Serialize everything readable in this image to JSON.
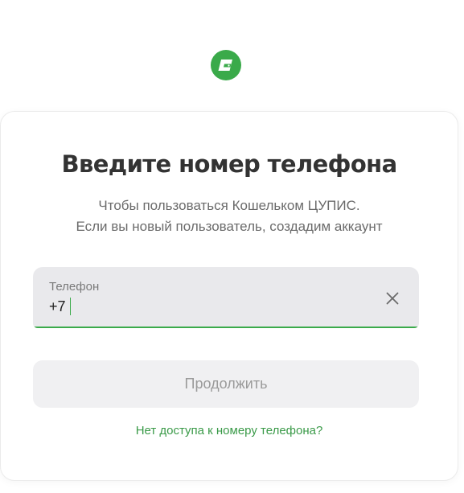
{
  "logo": {
    "icon": "wallet-logo-icon",
    "color": "#3aaa4a"
  },
  "header": {
    "title": "Введите номер телефона",
    "subtitle_line1": "Чтобы пользоваться Кошельком ЦУПИС.",
    "subtitle_line2": "Если вы новый пользователь, создадим аккаунт"
  },
  "phone_field": {
    "label": "Телефон",
    "value": "+7",
    "clear_icon": "close-icon"
  },
  "continue_button": {
    "label": "Продолжить"
  },
  "no_access_link": {
    "label": "Нет доступа к номеру телефона?"
  },
  "colors": {
    "accent": "#3aaa4a",
    "title": "#333333",
    "field_bg": "#e9e9ec",
    "button_bg": "#f0f0f2"
  }
}
